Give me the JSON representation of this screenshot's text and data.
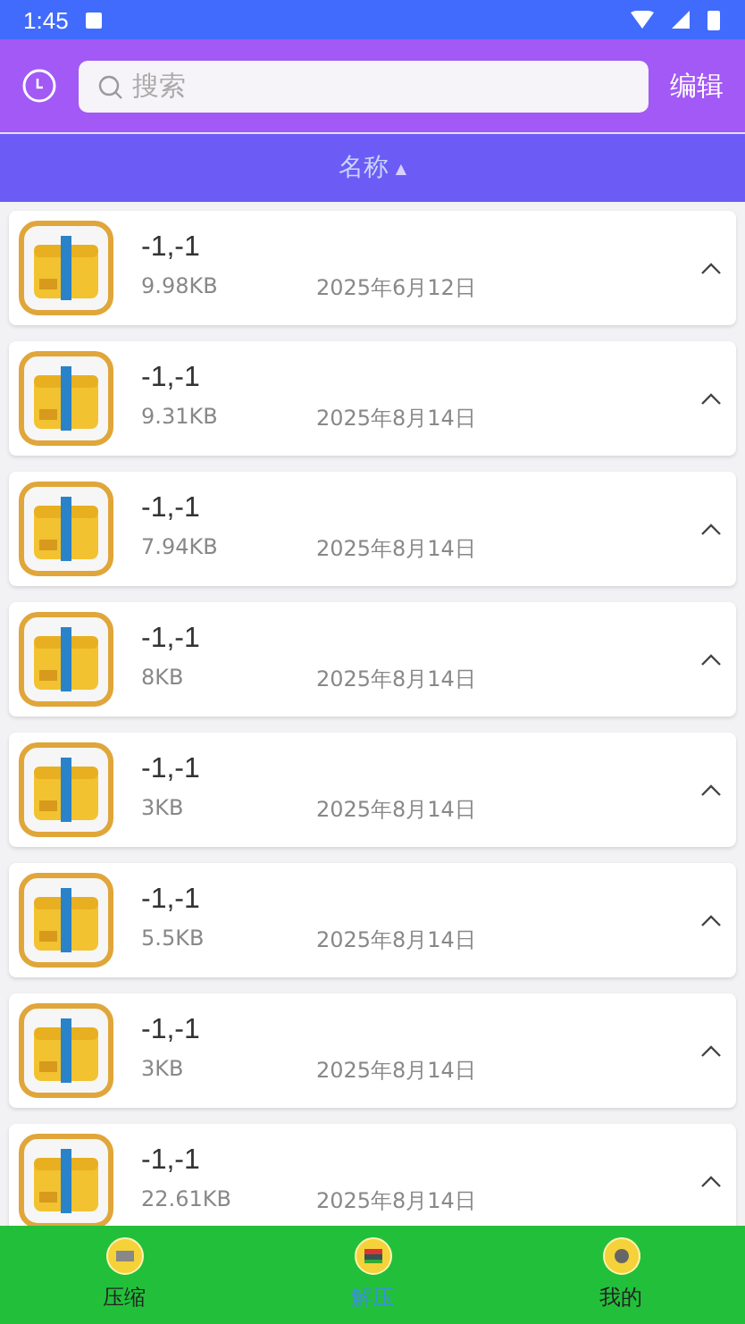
{
  "status_bar": {
    "time": "1:45"
  },
  "header": {
    "search": {
      "placeholder": "搜索"
    },
    "edit": "编辑"
  },
  "sort_bar": {
    "label": "名称",
    "arrow": "▲"
  },
  "files": [
    {
      "name": "-1,-1",
      "size": "9.98KB",
      "date": "2025年6月12日"
    },
    {
      "name": "-1,-1",
      "size": "9.31KB",
      "date": "2025年8月14日"
    },
    {
      "name": "-1,-1",
      "size": "7.94KB",
      "date": "2025年8月14日"
    },
    {
      "name": "-1,-1",
      "size": "8KB",
      "date": "2025年8月14日"
    },
    {
      "name": "-1,-1",
      "size": "3KB",
      "date": "2025年8月14日"
    },
    {
      "name": "-1,-1",
      "size": "5.5KB",
      "date": "2025年8月14日"
    },
    {
      "name": "-1,-1",
      "size": "3KB",
      "date": "2025年8月14日"
    },
    {
      "name": "-1,-1",
      "size": "22.61KB",
      "date": "2025年8月14日"
    }
  ],
  "tabs": [
    {
      "label": "压缩",
      "selected": false,
      "kind": "compress"
    },
    {
      "label": "解压",
      "selected": true,
      "kind": "extract"
    },
    {
      "label": "我的",
      "selected": false,
      "kind": "mine"
    }
  ]
}
